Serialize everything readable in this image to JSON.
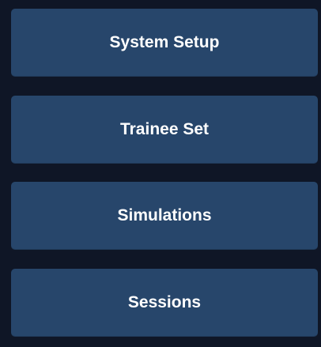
{
  "menu": {
    "items": [
      {
        "label": "System Setup"
      },
      {
        "label": "Trainee Set"
      },
      {
        "label": "Simulations"
      },
      {
        "label": "Sessions"
      }
    ]
  },
  "colors": {
    "background": "#0f1626",
    "button": "#27466b",
    "button_text": "#ffffff"
  }
}
